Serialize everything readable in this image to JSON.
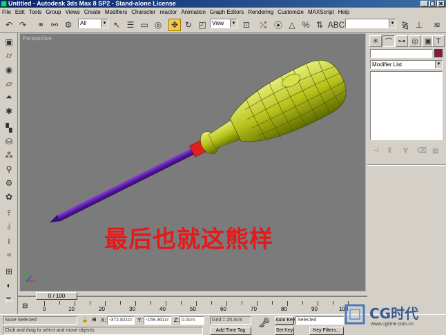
{
  "window": {
    "title": "Untitled - Autodesk 3ds Max 8 SP2 - Stand-alone License",
    "controls": [
      "_",
      "❐",
      "✕"
    ]
  },
  "menu": [
    "File",
    "Edit",
    "Tools",
    "Group",
    "Views",
    "Create",
    "Modifiers",
    "Character",
    "reactor",
    "Animation",
    "Graph Editors",
    "Rendering",
    "Customize",
    "MAXScript",
    "Help"
  ],
  "toolbar": {
    "selection_filter": "All",
    "reference_coord": "View",
    "named_selection": ""
  },
  "viewport": {
    "label": "Perspective",
    "overlay_text": "最后也就这熊样",
    "overlay_color": "#e81818",
    "background": "#7b7b7b"
  },
  "command_panel": {
    "object_name": "",
    "object_color": "#8b1a3d",
    "modifier_list": "Modifier List"
  },
  "time_slider": {
    "value": "0 / 100"
  },
  "trackbar": {
    "labels": [
      "0",
      "10",
      "20",
      "30",
      "40",
      "50",
      "60",
      "70",
      "80",
      "90",
      "100"
    ]
  },
  "status": {
    "selection": "None Selected",
    "prompt": "Click and drag to select and move objects",
    "x_label": "X:",
    "x_value": "-372.821cr",
    "y_label": "Y:",
    "y_value": "-159.361cr",
    "z_label": "Z:",
    "z_value": "0.0cm",
    "grid": "Grid = 25.4cm",
    "add_time_tag": "Add Time Tag",
    "auto_key": "Auto Key",
    "set_key": "Set Key",
    "key_mode": "Selected",
    "key_filters": "Key Filters..."
  },
  "watermark": {
    "brand": "CG时代",
    "url": "www.cgtime.com.cn"
  }
}
